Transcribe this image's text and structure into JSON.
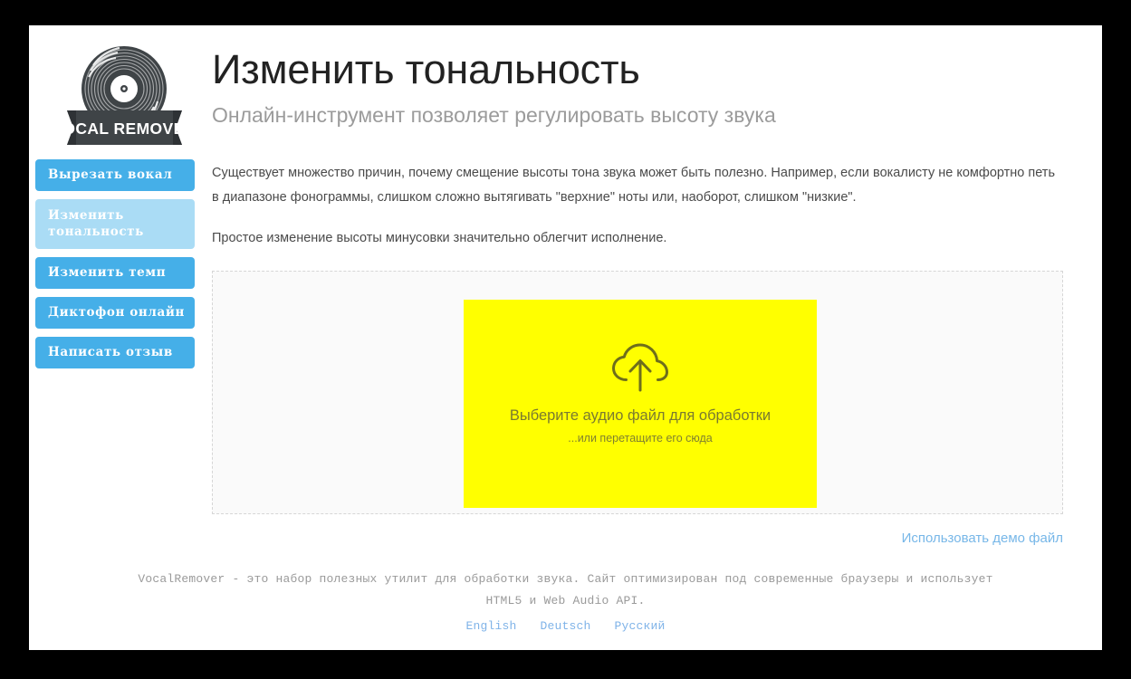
{
  "sidebar": {
    "logo": {
      "icon": "vinyl-record-icon",
      "banner_text": "VOCAL REMOVER"
    },
    "items": [
      {
        "label": "Вырезать вокал",
        "active": false
      },
      {
        "label": "Изменить тональность",
        "active": true
      },
      {
        "label": "Изменить темп",
        "active": false
      },
      {
        "label": "Диктофон онлайн",
        "active": false
      },
      {
        "label": "Написать отзыв",
        "active": false
      }
    ]
  },
  "header": {
    "title": "Изменить тональность",
    "subtitle": "Онлайн-инструмент позволяет регулировать высоту звука"
  },
  "content": {
    "paragraph_1": "Существует множество причин, почему смещение высоты тона звука может быть полезно. Например, если вокалисту не комфортно петь в диапазоне фонограммы, слишком сложно вытягивать \"верхние\" ноты или, наоборот, слишком \"низкие\".",
    "paragraph_2": "Простое изменение высоты минусовки значительно облегчит исполнение."
  },
  "upload": {
    "icon": "cloud-upload-icon",
    "title": "Выберите аудио файл для обработки",
    "hint": "...или перетащите его сюда",
    "dropzone_color": "#ffff00",
    "demo_link": "Использовать демо файл"
  },
  "footer": {
    "text": "VocalRemover - это набор полезных утилит для обработки звука. Сайт оптимизирован под современные браузеры и использует HTML5 и Web Audio API.",
    "languages": [
      "English",
      "Deutsch",
      "Русский"
    ]
  },
  "colors": {
    "accent_blue": "#45afe8",
    "accent_blue_active": "#aadcf5",
    "link_blue": "#77b7e8",
    "dropzone_yellow": "#ffff00",
    "logo_dark": "#3f4447"
  }
}
